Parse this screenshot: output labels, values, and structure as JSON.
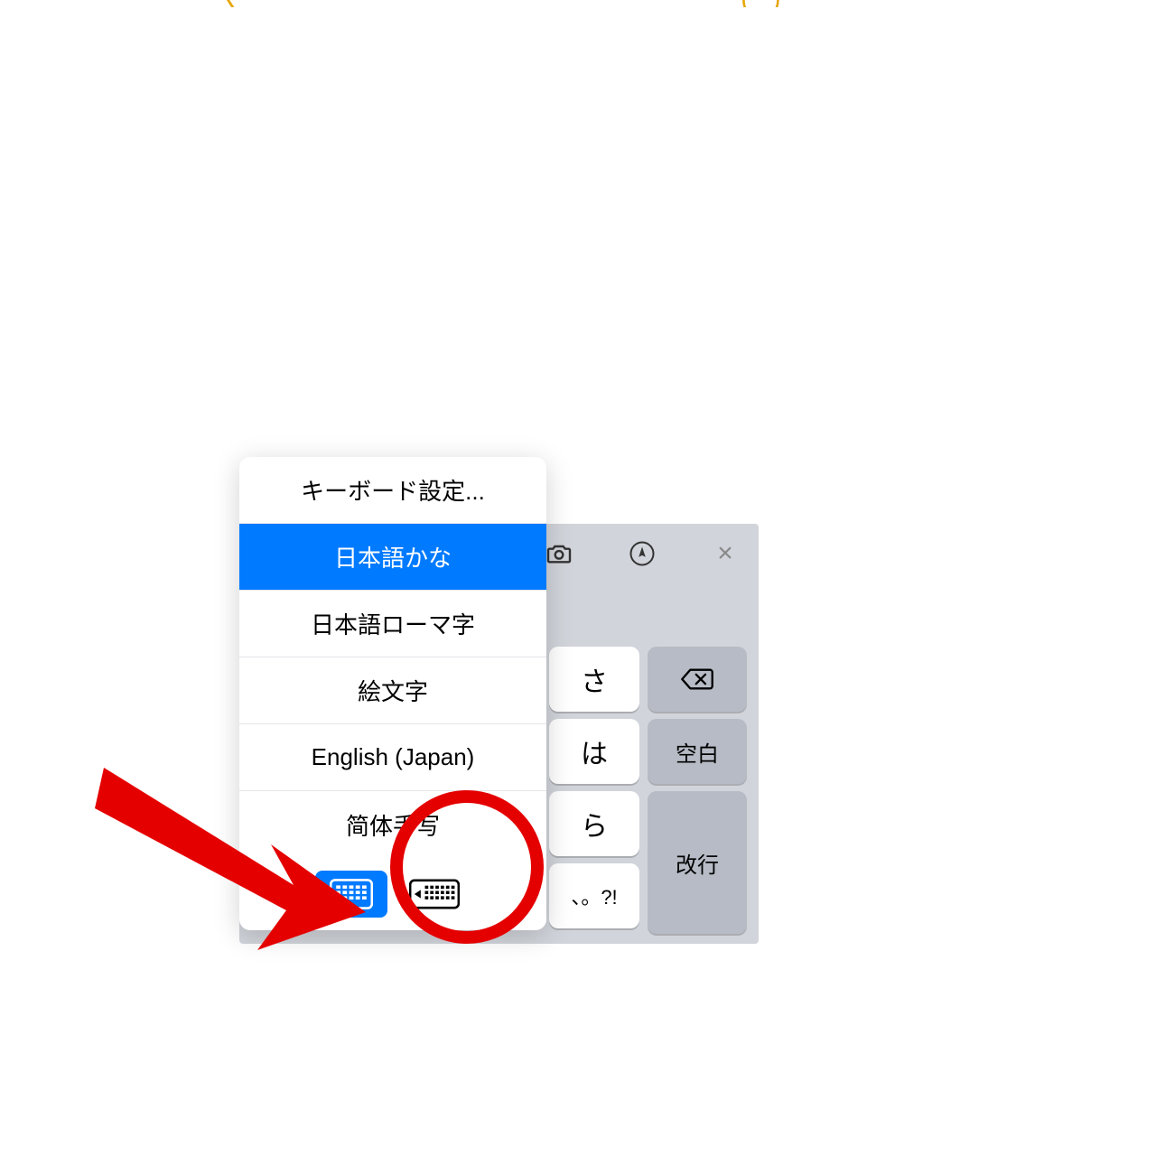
{
  "popup": {
    "settings": "キーボード設定...",
    "items": [
      {
        "label": "日本語かな",
        "selected": true
      },
      {
        "label": "日本語ローマ字",
        "selected": false
      },
      {
        "label": "絵文字",
        "selected": false
      },
      {
        "label": "English (Japan)",
        "selected": false
      },
      {
        "label": "简体手写",
        "selected": false
      }
    ],
    "layoutToggle": {
      "left_active": true
    }
  },
  "keyboard": {
    "toolbar": {
      "camera": "camera",
      "pen": "pen",
      "close": "×"
    },
    "keys": {
      "sa": "さ",
      "ha": "は",
      "ra": "ら",
      "symbols": "、。?!",
      "backspace": "⌫",
      "space": "空白",
      "return": "改行"
    }
  }
}
